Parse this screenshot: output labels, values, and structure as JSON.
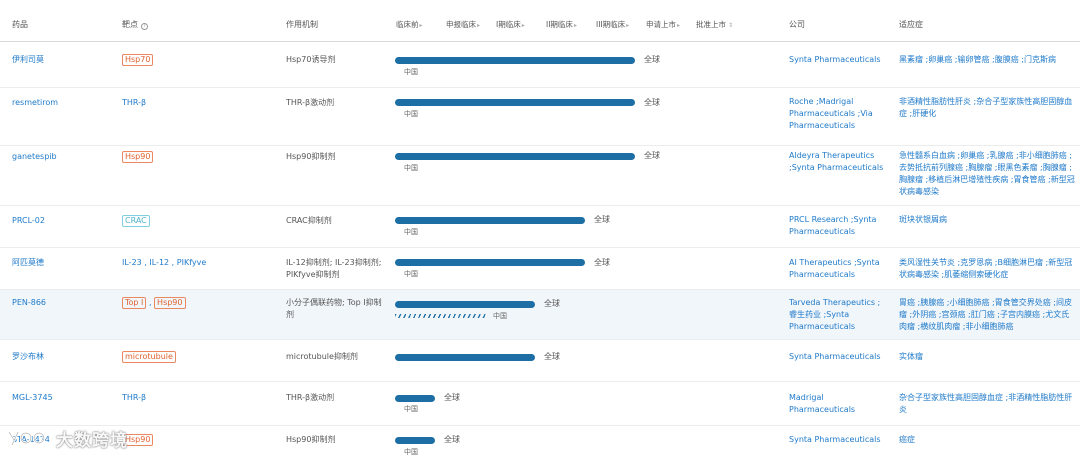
{
  "header": {
    "drug": "药品",
    "target": "靶点",
    "mechanism": "作用机制",
    "phases": [
      "临床前",
      "申报临床",
      "I期临床",
      "II期临床",
      "III期临床",
      "申请上市",
      "批准上市"
    ],
    "company": "公司",
    "indication": "适应症"
  },
  "labels": {
    "global": "全球",
    "china": "中国"
  },
  "rows": [
    {
      "drug": "伊利司莫",
      "targets": [
        "Hsp70"
      ],
      "mechanism": "Hsp70诱导剂",
      "progress_phase": "III期临床",
      "region": "全球",
      "sub_region": "中国",
      "company": "Synta Pharmaceuticals",
      "indication": "黑素瘤 ;卵巢癌 ;输卵管癌 ;腹膜癌 ;门克斯病"
    },
    {
      "drug": "resmetirom",
      "targets": [
        "THR-β"
      ],
      "mechanism": "THR-β激动剂",
      "progress_phase": "III期临床",
      "region": "全球",
      "sub_region": "中国",
      "company": "Roche ;Madrigal Pharmaceuticals ;Via Pharmaceuticals",
      "indication": "非酒精性脂肪性肝炎 ;杂合子型家族性高胆固醇血症 ;肝硬化"
    },
    {
      "drug": "ganetespib",
      "targets": [
        "Hsp90"
      ],
      "mechanism": "Hsp90抑制剂",
      "progress_phase": "III期临床",
      "region": "全球",
      "sub_region": "中国",
      "company": "Aldeyra Therapeutics ;Synta Pharmaceuticals",
      "indication": "急性髓系白血病 ;卵巢癌 ;乳腺癌 ;非小细胞肺癌 ;去势抵抗前列腺癌 ;胸腺瘤 ;眼黑色素瘤 ;胸腺瘤 ;胸腺瘤 ;移植后淋巴增殖性疾病 ;胃食管癌 ;新型冠状病毒感染"
    },
    {
      "drug": "PRCL-02",
      "targets": [
        "CRAC"
      ],
      "mechanism": "CRAC抑制剂",
      "progress_phase": "II期临床",
      "region": "全球",
      "sub_region": "中国",
      "company": "PRCL Research ;Synta Pharmaceuticals",
      "indication": "斑块状银屑病"
    },
    {
      "drug": "阿匹莫德",
      "targets": [
        "IL-23",
        "IL-12",
        "PIKfyve"
      ],
      "mechanism": "IL-12抑制剂; IL-23抑制剂; PIKfyve抑制剂",
      "progress_phase": "II期临床",
      "region": "全球",
      "sub_region": "中国",
      "company": "AI Therapeutics ;Synta Pharmaceuticals",
      "indication": "类风湿性关节炎 ;克罗恩病 ;B细胞淋巴瘤 ;新型冠状病毒感染 ;肌萎缩侧索硬化症"
    },
    {
      "drug": "PEN-866",
      "targets": [
        "Top I",
        "Hsp90"
      ],
      "mechanism": "小分子偶联药物; Top I抑制剂",
      "progress_phase": "II期临床",
      "region": "全球",
      "sub_region": "中国",
      "company": "Tarveda Therapeutics ;睿生药业 ;Synta Pharmaceuticals",
      "indication": "胃癌 ;胰腺癌 ;小细胞肺癌 ;胃食管交界处癌 ;间皮瘤 ;外阴癌 ;宫颈癌 ;肛门癌 ;子宫内膜癌 ;尤文氏肉瘤 ;横纹肌肉瘤 ;非小细胞肺癌"
    },
    {
      "drug": "罗沙布林",
      "targets": [
        "microtubule"
      ],
      "mechanism": "microtubule抑制剂",
      "progress_phase": "I期临床",
      "region": "全球",
      "sub_region": "",
      "company": "Synta Pharmaceuticals",
      "indication": "实体瘤"
    },
    {
      "drug": "MGL-3745",
      "targets": [
        "THR-β"
      ],
      "mechanism": "THR-β激动剂",
      "progress_phase": "临床前",
      "region": "全球",
      "sub_region": "中国",
      "company": "Madrigal Pharmaceuticals",
      "indication": "杂合子型家族性高胆固醇血症 ;非酒精性脂肪性肝炎"
    },
    {
      "drug": "STA-1474",
      "targets": [
        "Hsp90"
      ],
      "mechanism": "Hsp90抑制剂",
      "progress_phase": "临床前",
      "region": "全球",
      "sub_region": "中国",
      "company": "Synta Pharmaceuticals",
      "indication": "癌症"
    }
  ],
  "watermark": {
    "text": "大数跨境",
    "logo": "dashukuajing-logo"
  },
  "colors": {
    "bar": "#1c6ea4",
    "link": "#1f7ac9",
    "tag_orange": "#e0622f",
    "tag_cyan": "#4fb3cc",
    "highlight_row": "#f1f6fb"
  }
}
